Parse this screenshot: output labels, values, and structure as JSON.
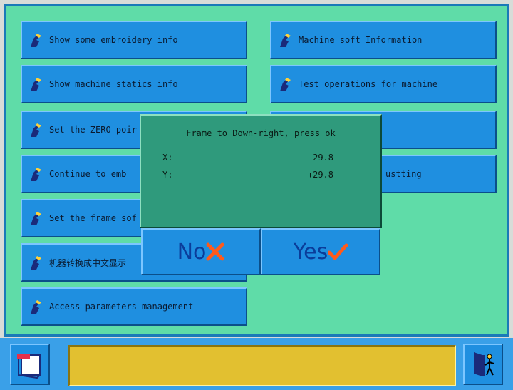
{
  "menu": {
    "left": [
      "Show some embroidery info",
      "Show machine statics info",
      "Set the ZERO poir",
      "Continue to emb",
      "Set the frame sof",
      "机器转换成中文显示",
      "Access parameters management"
    ],
    "right": [
      "Machine soft Information",
      "Test operations for machine",
      "",
      "ustting"
    ]
  },
  "dialog": {
    "title": "Frame to Down-right, press ok",
    "x_label": "X:",
    "x_value": "-29.8",
    "y_label": "Y:",
    "y_value": "+29.8",
    "no_label": "No",
    "yes_label": "Yes"
  },
  "status": {
    "text": ""
  },
  "colors": {
    "panel": "#5fdca8",
    "button": "#1f8fe0",
    "dialog": "#2f9a7c",
    "status": "#e2c030"
  },
  "icons": {
    "menu_item": "hand-pointer-icon",
    "no": "cross-icon",
    "yes": "check-icon",
    "left_bottom": "note-pad-icon",
    "right_bottom": "exit-door-icon"
  }
}
